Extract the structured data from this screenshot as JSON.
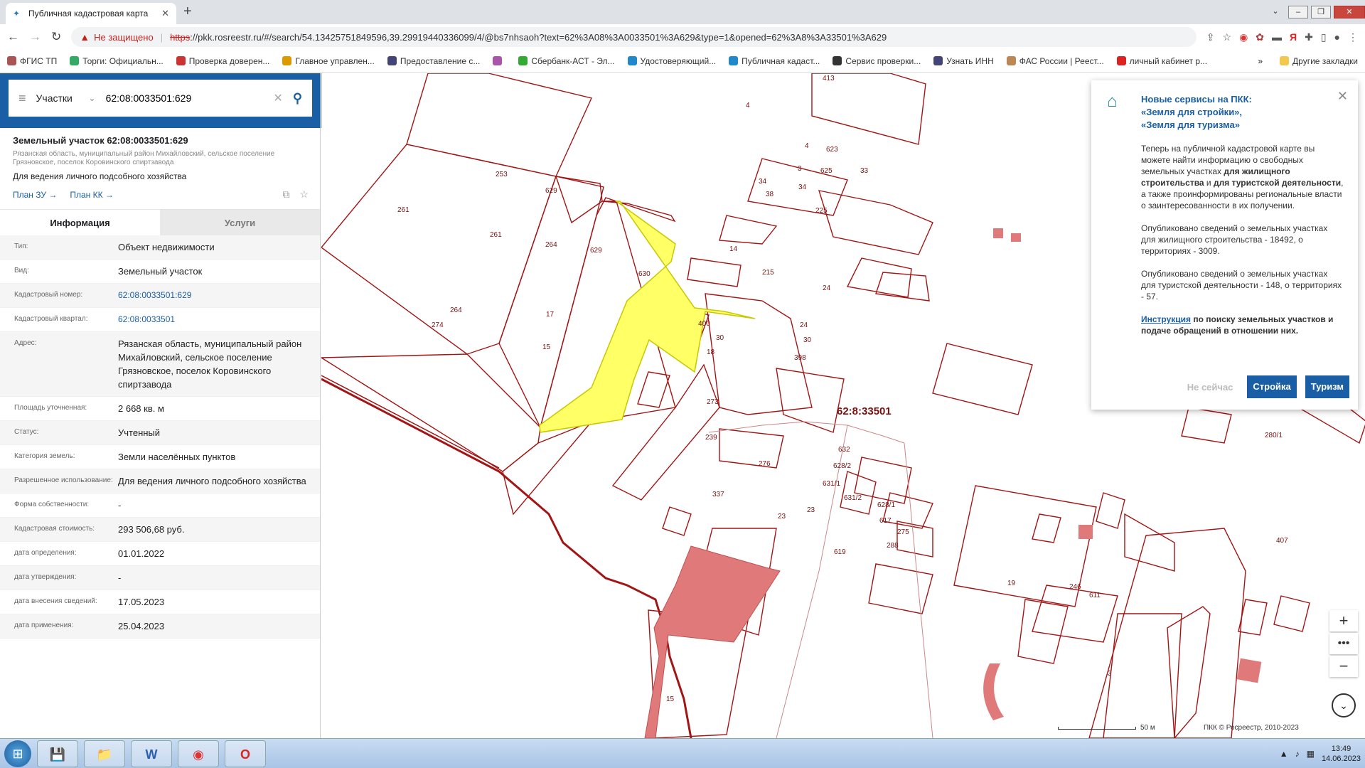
{
  "browser": {
    "tab_title": "Публичная кадастровая карта",
    "security_label": "Не защищено",
    "url_scheme": "https",
    "url_rest": "://pkk.rosreestr.ru/#/search/54.13425751849596,39.29919440336099/4/@bs7nhsaoh?text=62%3A08%3A0033501%3A629&type=1&opened=62%3A8%3A33501%3A629",
    "bookmarks": [
      {
        "label": "ФГИС ТП",
        "color": "#a55"
      },
      {
        "label": "Торги: Официальн...",
        "color": "#3a6"
      },
      {
        "label": "Проверка доверен...",
        "color": "#c33"
      },
      {
        "label": "Главное управлен...",
        "color": "#d90"
      },
      {
        "label": "Предоставление с...",
        "color": "#447"
      },
      {
        "label": "",
        "color": "#a5a"
      },
      {
        "label": "Сбербанк-АСТ - Эл...",
        "color": "#3a3"
      },
      {
        "label": "Удостоверяющий...",
        "color": "#28c"
      },
      {
        "label": "Публичная кадаст...",
        "color": "#28c"
      },
      {
        "label": "Сервис проверки...",
        "color": "#333"
      },
      {
        "label": "Узнать ИНН",
        "color": "#447"
      },
      {
        "label": "ФАС России | Реест...",
        "color": "#b85"
      },
      {
        "label": "личный кабинет р...",
        "color": "#d22"
      }
    ],
    "more_bookmarks": "»",
    "other_bookmarks": "Другие закладки"
  },
  "search": {
    "type_label": "Участки",
    "value": "62:08:0033501:629"
  },
  "parcel": {
    "title": "Земельный участок 62:08:0033501:629",
    "address_short": "Рязанская область, муниципальный район Михайловский, сельское поселение Грязновское, поселок Коровинского спиртзавода",
    "usage": "Для ведения личного подсобного хозяйства",
    "plan_zu": "План ЗУ →",
    "plan_kk": "План КК →"
  },
  "tabs": {
    "info": "Информация",
    "services": "Услуги"
  },
  "info_rows": [
    {
      "label": "Тип:",
      "value": "Объект недвижимости",
      "link": false
    },
    {
      "label": "Вид:",
      "value": "Земельный участок",
      "link": false
    },
    {
      "label": "Кадастровый номер:",
      "value": "62:08:0033501:629",
      "link": true
    },
    {
      "label": "Кадастровый квартал:",
      "value": "62:08:0033501",
      "link": true
    },
    {
      "label": "Адрес:",
      "value": "Рязанская область, муниципальный район Михайловский, сельское поселение Грязновское, поселок Коровинского спиртзавода",
      "link": false
    },
    {
      "label": "Площадь уточненная:",
      "value": "2 668 кв. м",
      "link": false
    },
    {
      "label": "Статус:",
      "value": "Учтенный",
      "link": false
    },
    {
      "label": "Категория земель:",
      "value": "Земли населённых пунктов",
      "link": false
    },
    {
      "label": "Разрешенное использование:",
      "value": "Для ведения личного подсобного хозяйства",
      "link": false
    },
    {
      "label": "Форма собственности:",
      "value": "-",
      "link": false
    },
    {
      "label": "Кадастровая стоимость:",
      "value": "293 506,68 руб.",
      "link": false
    },
    {
      "label": "дата определения:",
      "value": "01.01.2022",
      "link": false
    },
    {
      "label": "дата утверждения:",
      "value": "-",
      "link": false
    },
    {
      "label": "дата внесения сведений:",
      "value": "17.05.2023",
      "link": false
    },
    {
      "label": "дата применения:",
      "value": "25.04.2023",
      "link": false
    }
  ],
  "map": {
    "quarter_label": "62:8:33501",
    "parcel_labels": [
      "413",
      "4",
      "4",
      "625",
      "623",
      "3",
      "33",
      "34",
      "34",
      "38",
      "225",
      "14",
      "215",
      "24",
      "24",
      "30",
      "30",
      "398",
      "400",
      "18",
      "253",
      "261",
      "261",
      "264",
      "264",
      "17",
      "629",
      "629",
      "15",
      "630",
      "274",
      "273",
      "239",
      "276",
      "337",
      "23",
      "23",
      "632",
      "628/2",
      "631/1",
      "631/2",
      "628/1",
      "617",
      "275",
      "288",
      "619",
      "19",
      "246",
      "611",
      "407",
      "280/1",
      "3",
      "15"
    ],
    "selected_color": "#ffff66",
    "highlight_color": "#e07a7a",
    "line_color": "#a31515",
    "scale_label": "50 м",
    "copyright": "ПКК © Росреестр, 2010-2023"
  },
  "popup": {
    "title": "Новые сервисы на ПКК:\n«Земля для стройки»,\n«Земля для туризма»",
    "p1_a": "Теперь на публичной кадастровой карте вы можете найти информацию о свободных земельных участках ",
    "p1_b1": "для жилищного строительства",
    "p1_c": " и ",
    "p1_b2": "для туристской деятельности",
    "p1_d": ", а также проинформированы региональные власти о заинтересованности в их получении.",
    "p2": "Опубликовано сведений о земельных участках для жилищного строительства - 18492, о территориях - 3009.",
    "p3": "Опубликовано сведений о земельных участках для туристской деятельности - 148, о территориях - 57.",
    "link": "Инструкция",
    "link_rest": " по поиску земельных участков и подаче обращений в отношении них.",
    "btn_later": "Не сейчас",
    "btn_build": "Стройка",
    "btn_tourism": "Туризм"
  },
  "taskbar": {
    "time": "13:49",
    "date": "14.06.2023"
  }
}
